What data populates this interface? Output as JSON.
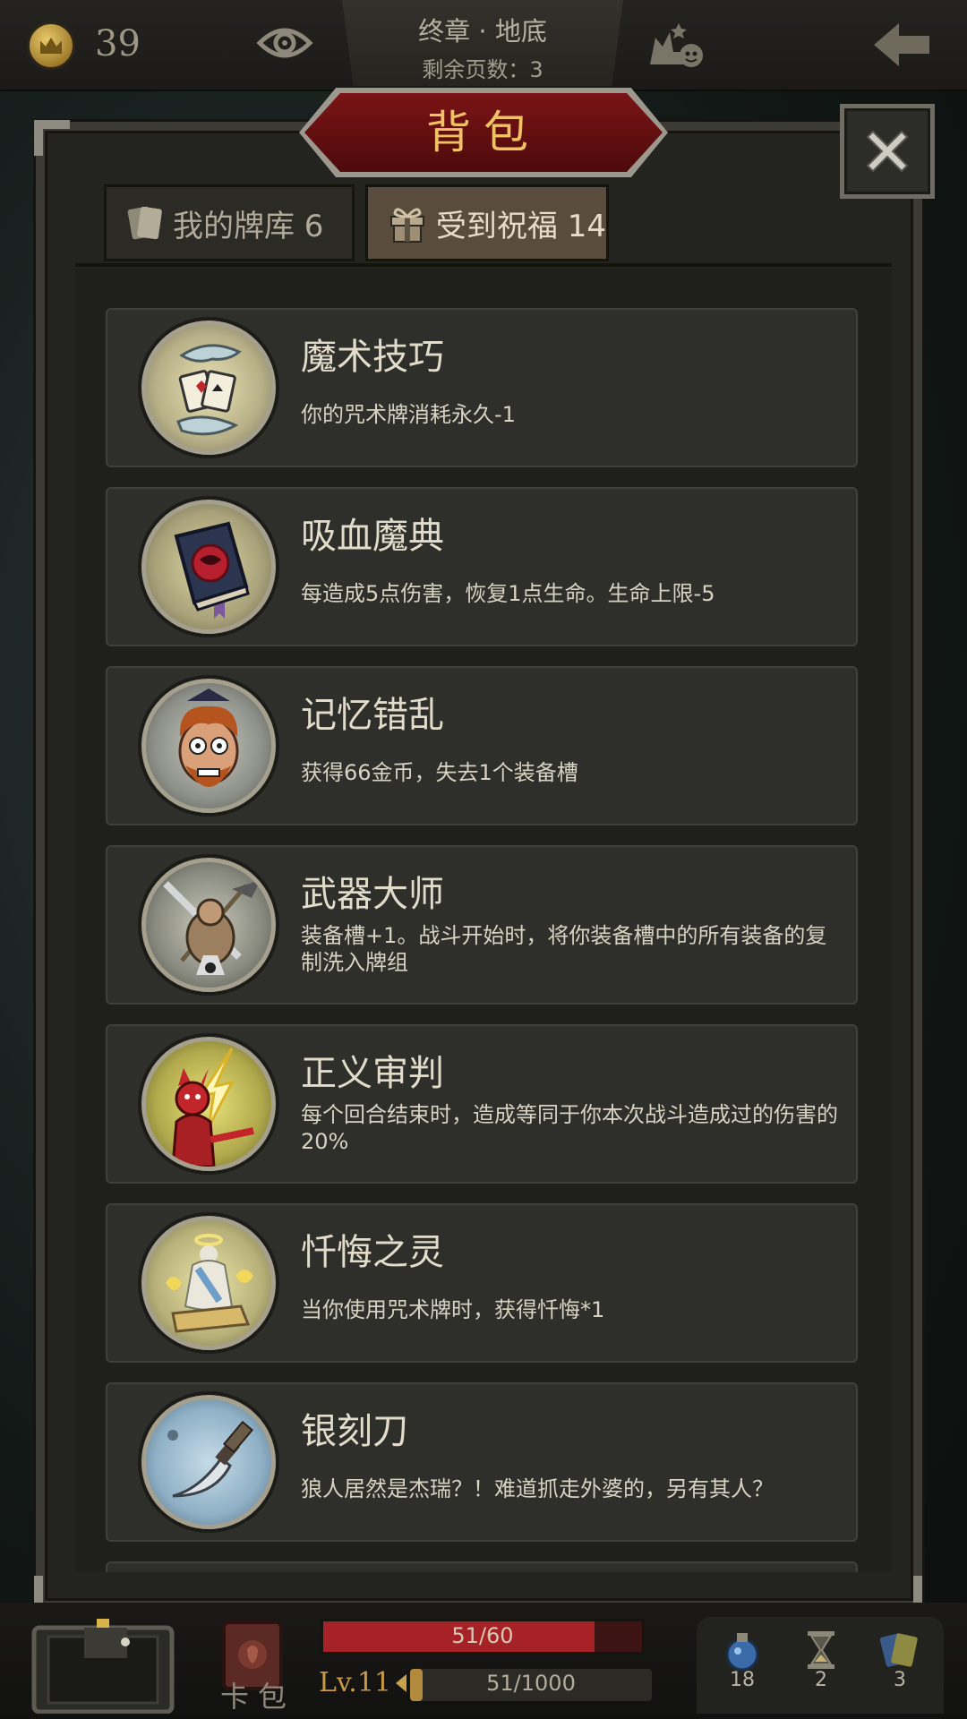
{
  "topbar": {
    "coins": "39",
    "chapter_title": "终章 · 地底",
    "pages_left": "剩余页数：3"
  },
  "panel": {
    "title": "背包",
    "tabs": [
      {
        "label": "我的牌库 6",
        "active": false
      },
      {
        "label": "受到祝福 14",
        "active": true
      }
    ]
  },
  "items": [
    {
      "name": "魔术技巧",
      "desc": "你的咒术牌消耗永久-1",
      "icon": "magic-hands-cards-icon"
    },
    {
      "name": "吸血魔典",
      "desc": "每造成5点伤害，恢复1点生命。生命上限-5",
      "icon": "vampire-tome-icon"
    },
    {
      "name": "记忆错乱",
      "desc": "获得66金币，失去1个装备槽",
      "icon": "confused-man-icon"
    },
    {
      "name": "武器大师",
      "desc": "装备槽+1。战斗开始时，将你装备槽中的所有装备的复制洗入牌组",
      "icon": "weapon-master-icon"
    },
    {
      "name": "正义审判",
      "desc": "每个回合结束时，造成等同于你本次战斗造成过的伤害的20%",
      "icon": "red-demon-lightning-icon"
    },
    {
      "name": "忏悔之灵",
      "desc": "当你使用咒术牌时，获得忏悔*1",
      "icon": "angel-spirit-icon"
    },
    {
      "name": "银刻刀",
      "desc": "狼人居然是杰瑞？！难道抓走外婆的，另有其人？",
      "icon": "silver-knife-icon"
    }
  ],
  "bottombar": {
    "deck_label": "卡包",
    "hp_text": "51/60",
    "hp_fraction": 0.85,
    "level": "Lv.11",
    "xp_text": "51/1000",
    "xp_fraction": 0.051,
    "stats": [
      {
        "icon": "potion-icon",
        "value": "18"
      },
      {
        "icon": "hourglass-icon",
        "value": "2"
      },
      {
        "icon": "cards-icon",
        "value": "3"
      }
    ]
  },
  "colors": {
    "banner_red": "#7b1416",
    "title_gold": "#f0c266",
    "hp_red": "#a72226",
    "panel_bg": "#23241f"
  }
}
